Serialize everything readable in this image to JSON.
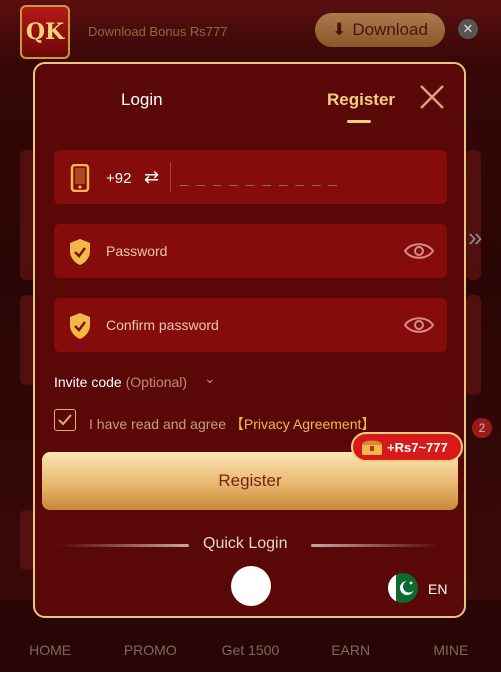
{
  "header": {
    "logo_text": "QK",
    "bonus_text": "Download Bonus Rs777",
    "download_label": "Download",
    "close_symbol": "✕"
  },
  "bottom_nav": [
    "HOME",
    "PROMO",
    "Get 1500",
    "EARN",
    "MINE"
  ],
  "notification_badge": "2",
  "modal": {
    "tabs": {
      "login": "Login",
      "register": "Register",
      "active": "register"
    },
    "phone": {
      "country_code": "+92",
      "placeholder": "_ _ _ _ _ _ _ _ _ _"
    },
    "password": {
      "placeholder": "Password"
    },
    "confirm_password": {
      "placeholder": "Confirm password"
    },
    "invite": {
      "label": "Invite code",
      "optional": "(Optional)"
    },
    "agreement": {
      "text": "I have read and agree",
      "link": "【Privacy Agreement】",
      "checked": true
    },
    "register_button": "Register",
    "bonus_pill": "+Rs7~777",
    "quick_login": "Quick Login",
    "language": "EN"
  },
  "colors": {
    "accent_gold": "#f2cf7f",
    "modal_bg": "#5a0707",
    "field_bg": "#860c0c",
    "bonus_red": "#d81919"
  }
}
